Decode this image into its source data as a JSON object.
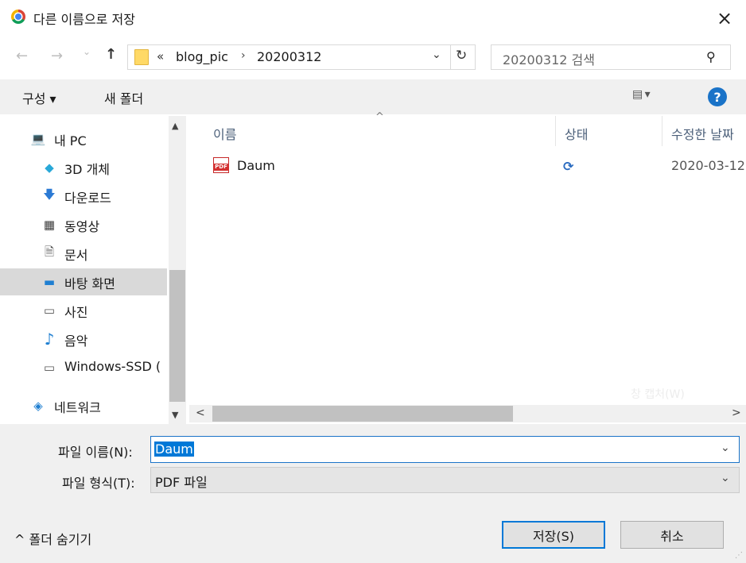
{
  "window": {
    "title": "다른 이름으로 저장",
    "close_icon": "×"
  },
  "address": {
    "back_icon": "←",
    "forward_icon": "→",
    "recent_icon": "⌄",
    "up_icon": "↑",
    "crumb_more": "«",
    "crumbs": [
      "blog_pic",
      "20200312"
    ],
    "separator": "›",
    "dropdown_icon": "⌄",
    "refresh_icon": "↻"
  },
  "search": {
    "placeholder": "20200312 검색",
    "icon": "⚲"
  },
  "toolbar": {
    "organize": "구성 ▾",
    "new_folder": "새 폴더",
    "view_icon": "▤ ▾",
    "help": "?"
  },
  "nav": {
    "items": [
      {
        "label": "내 PC",
        "icon": "💻"
      },
      {
        "label": "3D 개체",
        "icon": "◆"
      },
      {
        "label": "다운로드",
        "icon": "🡇"
      },
      {
        "label": "동영상",
        "icon": "▦"
      },
      {
        "label": "문서",
        "icon": "🗎"
      },
      {
        "label": "바탕 화면",
        "icon": "▬"
      },
      {
        "label": "사진",
        "icon": "▭"
      },
      {
        "label": "음악",
        "icon": "♪"
      },
      {
        "label": "Windows-SSD (",
        "icon": "▭"
      },
      {
        "label": "네트워크",
        "icon": "◈"
      }
    ],
    "scroll_up": "▲",
    "scroll_down": "▼"
  },
  "files": {
    "columns": [
      "이름",
      "상태",
      "수정한 날짜"
    ],
    "sort_indicator": "^",
    "rows": [
      {
        "name": "Daum",
        "status_icon": "⟳",
        "date": "2020-03-12"
      }
    ],
    "pdf_badge": "PDF",
    "scroll_left": "<",
    "scroll_right": ">"
  },
  "watermark": "창 캡처(W)",
  "form": {
    "filename_label": "파일 이름(N):",
    "filename_value": "Daum",
    "filetype_label": "파일 형식(T):",
    "filetype_value": "PDF 파일",
    "dropdown_icon": "⌄"
  },
  "footer": {
    "hide_folders": "^  폴더 숨기기",
    "save": "저장(S)",
    "cancel": "취소",
    "grip": "⋰"
  }
}
